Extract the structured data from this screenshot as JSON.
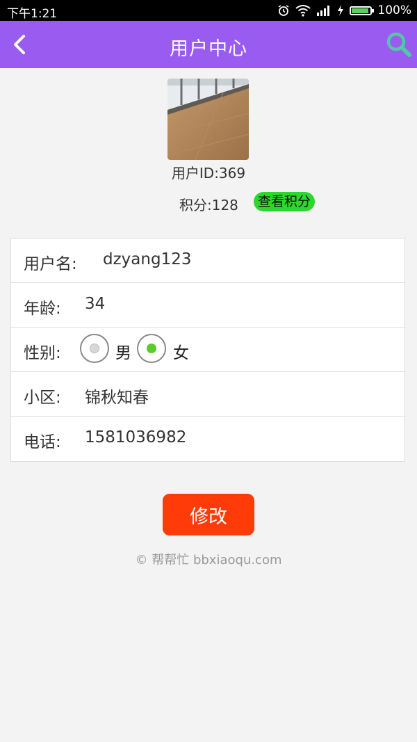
{
  "status_bar": {
    "time": "下午1:21",
    "battery": "100%"
  },
  "header": {
    "title": "用户中心"
  },
  "profile": {
    "user_id": "用户ID:369",
    "points": "积分:128",
    "view_points_label": "查看积分"
  },
  "fields": {
    "username_label": "用户名:",
    "username_value": "dzyang123",
    "age_label": "年龄:",
    "age_value": "34",
    "gender_label": "性别:",
    "gender_male": "男",
    "gender_female": "女",
    "gender_selected": "女",
    "community_label": "小区:",
    "community_value": "锦秋知春",
    "phone_label": "电话:",
    "phone_value": "1581036982"
  },
  "actions": {
    "submit_label": "修改"
  },
  "footer": {
    "text": "© 帮帮忙 bbxiaoqu.com"
  },
  "colors": {
    "header_bg": "#9a5cf0",
    "accent_green": "#2cd82c",
    "submit_bg": "#ff3b0a",
    "search_icon": "#4fc9a8"
  }
}
